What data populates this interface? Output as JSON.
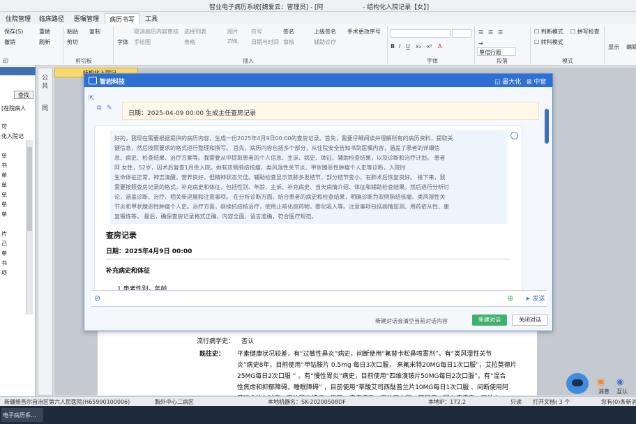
{
  "window": {
    "title": "智业电子病历系统[魏爱云：管理员] - [阿",
    "title_suffix": "- 结构化入院记录【女】]"
  },
  "ribbon_tabs": [
    "住院管理",
    "临床路径",
    "医嘱管理",
    "病历书写",
    "工具"
  ],
  "active_tab": "病历书写",
  "ribbon": {
    "save_label": "保存(S)",
    "reset_label": "重做",
    "paste_label": "粘贴",
    "copy_label": "复制",
    "undo_label": "撤销",
    "refresh_label": "刷新",
    "cut_label": "剪切",
    "font_face_label": "字体",
    "cancel_review_label": "取消病历内容审核",
    "select_region_label": "选择列表",
    "image_label": "图片",
    "symbol_label": "符号",
    "sign_label": "签名",
    "upper_sign_label": "上级签名",
    "handwrite_label": "手术更改序号",
    "handdraw_label": "手绘图",
    "table_label": "表格",
    "zml_label": "ZML",
    "datetime_label": "日期与时间",
    "check_label": "审核",
    "aux_label": "辅助诊疗",
    "group_clipboard": "剪切板",
    "group_insert": "插入",
    "group_font": "字体",
    "group_paragraph": "段落",
    "group_mode": "模式",
    "group_print": "印",
    "revise_mode": "判断模式",
    "spellcheck": "拼写检查",
    "special_mode": "转科模式",
    "display_label": "显示",
    "edit_label": "编辑",
    "line_spacing": "单倍行距",
    "font_sample": "A"
  },
  "left_panel": {
    "search_button": "查找",
    "filter": "[在院病人",
    "items": [
      "可",
      "化入院记",
      "单",
      "书",
      "单",
      "单",
      "单",
      "单",
      "单",
      "片",
      "己",
      "单",
      "书",
      "项"
    ]
  },
  "vertical_strip": [
    "公",
    "共",
    "同"
  ],
  "doc_tab": "结构化入院记",
  "dialog": {
    "brand": "智岩科技",
    "maximize": "最大化",
    "medium": "中窗",
    "date_bubble": "日期：2025-04-09 00:00   生成主任查房记录",
    "thinking": [
      "好的，我现在需要根据提供的病历内容，生成一份2025年4月9日00:00的查房记录。首先，我要仔细阅读并理解所有的病历资料，提取关",
      "键信息，然后按照要求的格式进行整理和撰写。 首先，病历内容包括多个部分，从住院安全告知书到医嘱内容，涵盖了患者的详细信",
      "息、病史、检查结果、治疗方案等。我需要从中提取患者的个人信息、主诉、病史、体征、辅助检查结果，以及诊断和治疗计划。 患者",
      "阿              女性，52岁，因术后复查1月余入院。她有双侧肺结核瘤、类风湿性关节炎、甲状腺恶性肿瘤个人史等诊断，入院时",
      "生命体征正常，神志清醒，营养良好，但精神状态欠佳。辅助检查显示双肺多发结节，部分结节变小，右肺术后恢复良好。 接下来，我",
      "需要按照查房记录的格式，补充病史和体征，包括性别、年龄、主诉、补充病史、当天病情介绍、体征和辅助检查结果。然后进行分析讨",
      "论，涵盖诊断、治疗、相关新进展和注意事项。 在分析诊断方面，结合患者的病史和检查结果，明确诊断为双侧肺结核瘤、类风湿性关",
      "节炎和甲状腺恶性肿瘤个人史。治疗方面，继续抗结核治疗，使用止咳化痰药物，雾化吸入等。注意事项包括病情监测、用药依从性、康",
      "复锻炼等。 最后，确保查房记录格式正确，内容全面，语言准确，符合医疗规范。"
    ],
    "answer_title": "查房记录",
    "answer_date": "日期：2025年4月9日 00:00",
    "answer_section": "补充病史和体征",
    "answer_item": "1  患者性别，年龄",
    "send": "发送",
    "footer_hint": "新建对话会清空当前对话内容",
    "new_chat": "新建对话",
    "close_chat": "关闭对话"
  },
  "document": {
    "epi_history_label": "流行病学史：",
    "epi_history_value": "否认",
    "past_history_label": "既往史：",
    "past_lines": [
      "平素健康状况较差，有“过敏性鼻炎”病史，间断使用“氟替卡松鼻喷雾剂”。有“类风湿性关节",
      "炎”病史8年，目前使用“甲钴胺片 0.5mg 每日3次口服， 来氟米特20MG每日1次口服”，艾拉莫德片",
      "25MG每日2次口服 ” 。有“慢性胃炎”病史，目前使用“四维溴铵片50MG每日2次口服”。有“混合",
      "性焦虑和抑郁障碍，睡眠障碍” ，目前使用“草酸艾司西酞普兰片10MG每日1次口服 、间断使用阿",
      "普唑仑片” 对症。否认肝炎结核、伤寒、疟疾病史。否认高血压、糖尿病、冠心病病史。否认心"
    ]
  },
  "status_bar": {
    "hospital": "新疆维吾尔自治区第六人民医院(H65990100006)",
    "ward": "胸外中心二病区",
    "machine": "本地机器名：SK-20200508DF",
    "ip": "本地IP：172.2",
    "readonly": "只读",
    "print_count": "打开文档( 3 个",
    "notice": "您有(0)条新消"
  },
  "right_widgets": {
    "message": "消息",
    "interact": "互认"
  },
  "taskbar": {
    "app": "电子病历系..."
  }
}
